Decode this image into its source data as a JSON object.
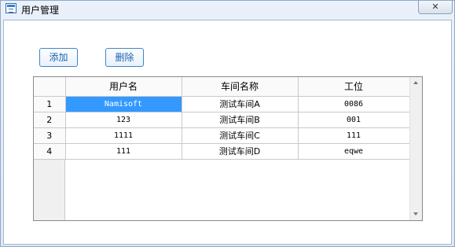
{
  "window": {
    "title": "用户管理",
    "close_symbol": "✕"
  },
  "toolbar": {
    "add_label": "添加",
    "delete_label": "删除"
  },
  "grid": {
    "columns": [
      "用户名",
      "车间名称",
      "工位"
    ],
    "rows": [
      {
        "num": "1",
        "user": "Namisoft",
        "workshop": "测试车间A",
        "station": "0086"
      },
      {
        "num": "2",
        "user": "123",
        "workshop": "测试车间B",
        "station": "001"
      },
      {
        "num": "3",
        "user": "1111",
        "workshop": "测试车间C",
        "station": "111"
      },
      {
        "num": "4",
        "user": "111",
        "workshop": "测试车间D",
        "station": "eqwe"
      }
    ],
    "selected_row": 0,
    "selected_column": "user"
  },
  "colors": {
    "accent": "#3f86c8",
    "selection": "#3399ff"
  },
  "icons": {
    "app": "window-app-icon",
    "close": "close-icon",
    "scroll_up": "scroll-up-arrow-icon",
    "scroll_down": "scroll-down-arrow-icon"
  }
}
